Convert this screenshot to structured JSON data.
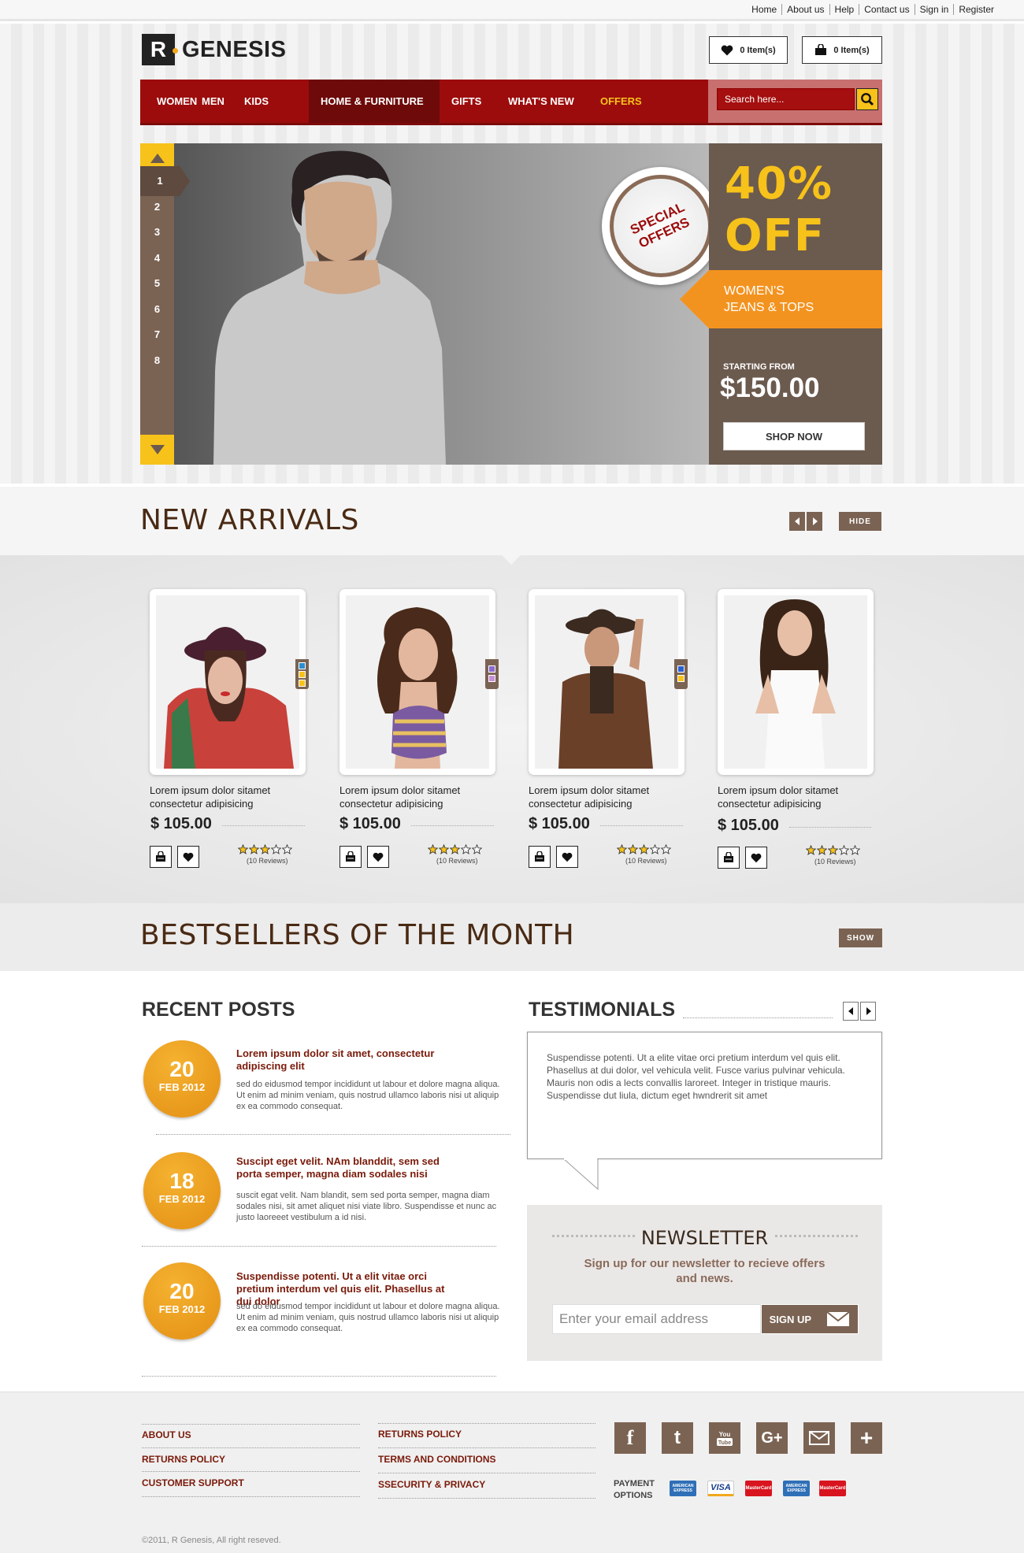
{
  "top_links": [
    "Home",
    "About us",
    "Help",
    "Contact us",
    "Sign in",
    "Register"
  ],
  "brand": {
    "mark": "R",
    "name": "GENESIS"
  },
  "wishlist": {
    "label": "0 Item(s)"
  },
  "cart": {
    "label": "0 Item(s)"
  },
  "nav": {
    "items": [
      "WOMEN",
      "MEN",
      "KIDS",
      "HOME & FURNITURE",
      "GIFTS",
      "WHAT'S  NEW",
      "OFFERS"
    ],
    "active": "HOME & FURNITURE",
    "search_placeholder": "Search here..."
  },
  "hero": {
    "slide_numbers": [
      "1",
      "2",
      "3",
      "4",
      "5",
      "6",
      "7",
      "8"
    ],
    "active_slide": "1",
    "badge": "SPECIAL OFFERS",
    "discount": "40%",
    "discount_suffix": "OFF",
    "offer_label": "WOMEN'S\nJEANS & TOPS",
    "starting_label": "STARTING FROM",
    "price": "$150.00",
    "cta": "SHOP NOW"
  },
  "new_arrivals": {
    "title": "NEW ARRIVALS",
    "hide_label": "HIDE",
    "products": [
      {
        "name": "Lorem ipsum dolor sitamet\nconsectetur adipisicing",
        "price": "$ 105.00",
        "reviews": "(10 Reviews)",
        "rating": 3,
        "swatches": [
          "#2a8fd0",
          "#f7c21a",
          "#f7c21a"
        ]
      },
      {
        "name": "Lorem ipsum dolor sitamet\nconsectetur adipisicing",
        "price": "$ 105.00",
        "reviews": "(10 Reviews)",
        "rating": 3,
        "swatches": [
          "#8a6ad0",
          "#c890d8"
        ]
      },
      {
        "name": "Lorem ipsum dolor sitamet\nconsectetur adipisicing",
        "price": "$ 105.00",
        "reviews": "(10 Reviews)",
        "rating": 3,
        "swatches": [
          "#2a5fd0",
          "#f7c21a"
        ]
      },
      {
        "name": "Lorem ipsum dolor sitamet\nconsectetur adipisicing",
        "price": "$ 105.00",
        "reviews": "(10 Reviews)",
        "rating": 3,
        "swatches": []
      }
    ]
  },
  "bestsellers": {
    "title": "BESTSELLERS OF THE MONTH",
    "show_label": "SHOW"
  },
  "recent_posts": {
    "title": "RECENT POSTS",
    "posts": [
      {
        "day": "20",
        "month": "FEB 2012",
        "title": "Lorem ipsum dolor sit amet, consectetur adipiscing elit",
        "body": "sed do eidusmod tempor incididunt ut labour et dolore magna aliqua. Ut enim ad minim veniam, quis nostrud ullamco laboris nisi ut aliquip ex ea commodo consequat."
      },
      {
        "day": "18",
        "month": "FEB 2012",
        "title": "Suscipt eget velit. NAm blanddit, sem sed porta semper, magna diam sodales nisi",
        "body": "suscit egat velit. Nam blandit, sem sed porta semper, magna diam sodales nisi, sit amet aliquet nisi viate libro. Suspendisse et nunc ac justo laoreeet vestibulum a id nisi."
      },
      {
        "day": "20",
        "month": "FEB 2012",
        "title": "Suspendisse potenti. Ut a elit vitae orci pretium interdum vel quis elit. Phasellus at dui dolor",
        "body": "sed do eidusmod tempor incididunt ut labour et dolore magna aliqua. Ut enim ad minim veniam, quis nostrud ullamco laboris nisi ut aliquip ex ea commodo consequat."
      }
    ]
  },
  "testimonials": {
    "title": "TESTIMONIALS",
    "text": "Suspendisse potenti. Ut a elite vitae orci pretium interdum vel quis elit. Phasellus at dui dolor, vel vehicula velit. Fusce varius pulvinar vehicula. Mauris non odis a lects convallis laroreet. Integer in tristique mauris. Suspendisse dut liula, dictum eget hwndrerit sit amet"
  },
  "newsletter": {
    "title": "NEWSLETTER",
    "subtitle": "Sign up for our newsletter to recieve offers and news.",
    "placeholder": "Enter your email address",
    "button": "SIGN UP"
  },
  "footer": {
    "col1": [
      "ABOUT US",
      "RETURNS POLICY",
      "CUSTOMER SUPPORT"
    ],
    "col2": [
      "RETURNS POLICY",
      "TERMS AND CONDITIONS",
      "SSECURITY & PRIVACY"
    ],
    "social": [
      "facebook-icon",
      "tumblr-icon",
      "youtube-icon",
      "google-plus-icon",
      "mail-icon",
      "plus-icon"
    ],
    "payment_label": "PAYMENT\nOPTIONS",
    "payments": [
      "AMERICAN EXPRESS",
      "VISA",
      "MasterCard",
      "AMERICAN EXPRESS",
      "MasterCard"
    ],
    "copyright": "©2011, R Genesis, All right reseved."
  },
  "colors": {
    "accent_red": "#9c0c0c",
    "brand_brown": "#7b6353",
    "gold": "#f7c21a",
    "orange": "#f3931f"
  }
}
